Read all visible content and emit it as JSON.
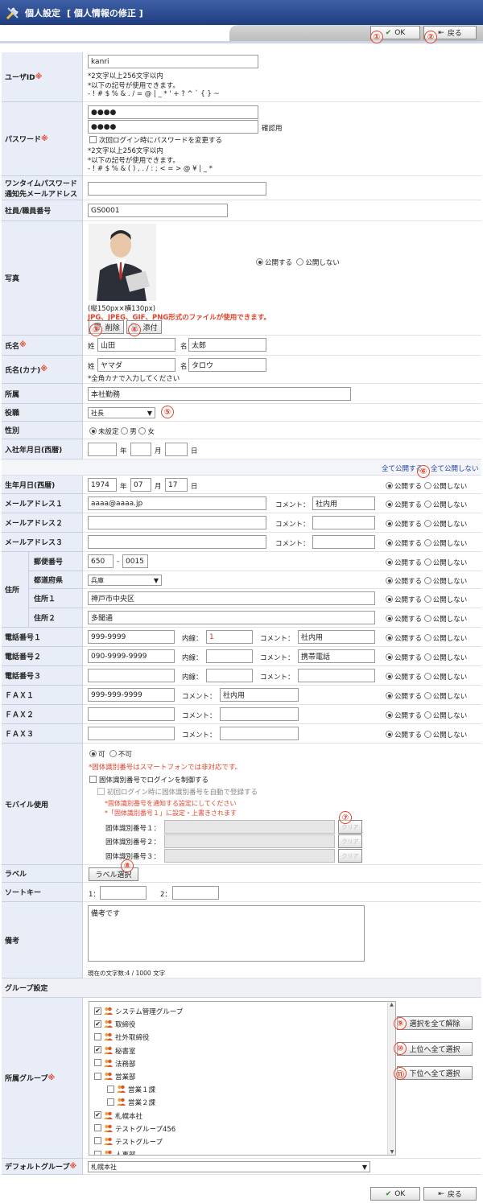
{
  "header": {
    "title": "個人設定",
    "subtitle": "[ 個人情報の修正 ]"
  },
  "buttons": {
    "ok": "OK",
    "back": "戻る",
    "delete": "削除",
    "attach": "添付",
    "label_select": "ラベル選択",
    "deselect_all": "選択を全て解除",
    "select_parent": "上位へ全て選択",
    "select_child": "下位へ全て選択"
  },
  "markers": [
    "①",
    "②",
    "③",
    "④",
    "⑤",
    "⑥",
    "⑦",
    "⑧",
    "⑨",
    "⑩",
    "⑪"
  ],
  "common": {
    "public": "公開する",
    "private": "公開しない",
    "comment": "コメント：",
    "ext": "内線：",
    "year": "年",
    "month": "月",
    "day": "日",
    "req": "※",
    "sei": "姓",
    "mei": "名"
  },
  "userid": {
    "label": "ユーザID",
    "value": "kanri",
    "hint1": "*2文字以上256文字以内",
    "hint2": "*以下の記号が使用できます。",
    "hint3": "- ! # $ % & . / = @ | _ * ' + ? ^ ` { } ~"
  },
  "password": {
    "label": "パスワード",
    "value": "●●●●",
    "confirm_value": "●●●●",
    "confirm_label": "確認用",
    "change_next": "次回ログイン時にパスワードを変更する",
    "hint1": "*2文字以上256文字以内",
    "hint2": "*以下の記号が使用できます。",
    "hint3": "- ! # $ % & ( ) , . / : ; < = > @ ¥ | _ *"
  },
  "otp": {
    "label1": "ワンタイムパスワード",
    "label2": "通知先メールアドレス",
    "value": ""
  },
  "empno": {
    "label": "社員/職員番号",
    "value": "GS0001"
  },
  "photo": {
    "label": "写真",
    "size": "(縦150px×横130px)",
    "formats": "JPG、JPEG、GIF、PNG形式のファイルが使用できます。"
  },
  "name": {
    "label": "氏名",
    "sei": "山田",
    "mei": "太郎"
  },
  "kana": {
    "label": "氏名(カナ)",
    "sei": "ヤマダ",
    "mei": "タロウ",
    "hint": "*全角カナで入力してください"
  },
  "dept": {
    "label": "所属",
    "value": "本社勤務"
  },
  "position": {
    "label": "役職",
    "value": "社長"
  },
  "gender": {
    "label": "性別",
    "opt1": "未設定",
    "opt2": "男",
    "opt3": "女"
  },
  "joined": {
    "label": "入社年月日(西暦)",
    "y": "",
    "m": "",
    "d": ""
  },
  "bulk": {
    "all_public": "全て公開する",
    "all_private": "全て公開しない"
  },
  "birth": {
    "label": "生年月日(西暦)",
    "y": "1974",
    "m": "07",
    "d": "17"
  },
  "mail1": {
    "label": "メールアドレス１",
    "value": "aaaa@aaaa.jp",
    "comment": "社内用"
  },
  "mail2": {
    "label": "メールアドレス２",
    "value": "",
    "comment": ""
  },
  "mail3": {
    "label": "メールアドレス３",
    "value": "",
    "comment": ""
  },
  "address": {
    "label": "住所",
    "zip_label": "郵便番号",
    "zip1": "650",
    "zip2": "0015",
    "dash": "-",
    "pref_label": "都道府県",
    "pref": "兵庫",
    "addr1_label": "住所１",
    "addr1": "神戸市中央区",
    "addr2_label": "住所２",
    "addr2": "多聞通"
  },
  "tel1": {
    "label": "電話番号１",
    "value": "999-9999",
    "ext": "1",
    "comment": "社内用"
  },
  "tel2": {
    "label": "電話番号２",
    "value": "090-9999-9999",
    "ext": "",
    "comment": "携帯電話"
  },
  "tel3": {
    "label": "電話番号３",
    "value": "",
    "ext": "",
    "comment": ""
  },
  "fax1": {
    "label": "ＦＡＸ１",
    "value": "999-999-9999",
    "comment": "社内用"
  },
  "fax2": {
    "label": "ＦＡＸ２",
    "value": "",
    "comment": ""
  },
  "fax3": {
    "label": "ＦＡＸ３",
    "value": "",
    "comment": ""
  },
  "mobile": {
    "label": "モバイル使用",
    "allow": "可",
    "deny": "不可",
    "note1": "*固体識別番号はスマートフォンでは非対応です。",
    "chk1": "固体識別番号でログインを制御する",
    "chk2": "初回ログイン時に固体識別番号を自動で登録する",
    "note2": "*固体識別番号を通知する設定にしてください",
    "note3": "*「固体識別番号１」に設定・上書きされます",
    "id1": "固体識別番号１：",
    "id2": "固体識別番号２：",
    "id3": "固体識別番号３：",
    "clear": "クリア"
  },
  "label_row": {
    "label": "ラベル"
  },
  "sortkey": {
    "label": "ソートキー",
    "k1": "1：",
    "k2": "2："
  },
  "memo": {
    "label": "備考",
    "value": "備考です",
    "counter": "現在の文字数:4 / 1000 文字"
  },
  "group": {
    "section": "グループ設定",
    "label": "所属グループ",
    "items": [
      {
        "name": "システム管理グループ",
        "checked": true,
        "indent": 0
      },
      {
        "name": "取締役",
        "checked": true,
        "indent": 0
      },
      {
        "name": "社外取締役",
        "checked": false,
        "indent": 0
      },
      {
        "name": "秘書室",
        "checked": true,
        "indent": 0
      },
      {
        "name": "法務部",
        "checked": false,
        "indent": 0
      },
      {
        "name": "営業部",
        "checked": false,
        "indent": 0
      },
      {
        "name": "営業１課",
        "checked": false,
        "indent": 1
      },
      {
        "name": "営業２課",
        "checked": false,
        "indent": 1
      },
      {
        "name": "札幌本社",
        "checked": true,
        "indent": 0
      },
      {
        "name": "テストグループ456",
        "checked": false,
        "indent": 0
      },
      {
        "name": "テストグループ",
        "checked": false,
        "indent": 0
      },
      {
        "name": "人事部",
        "checked": false,
        "indent": 0
      }
    ]
  },
  "defgroup": {
    "label": "デフォルトグループ",
    "value": "札幌本社"
  },
  "colors": {
    "accent": "#e0442c",
    "header": "#2a4a8f",
    "label_bg": "#e9edf7"
  }
}
